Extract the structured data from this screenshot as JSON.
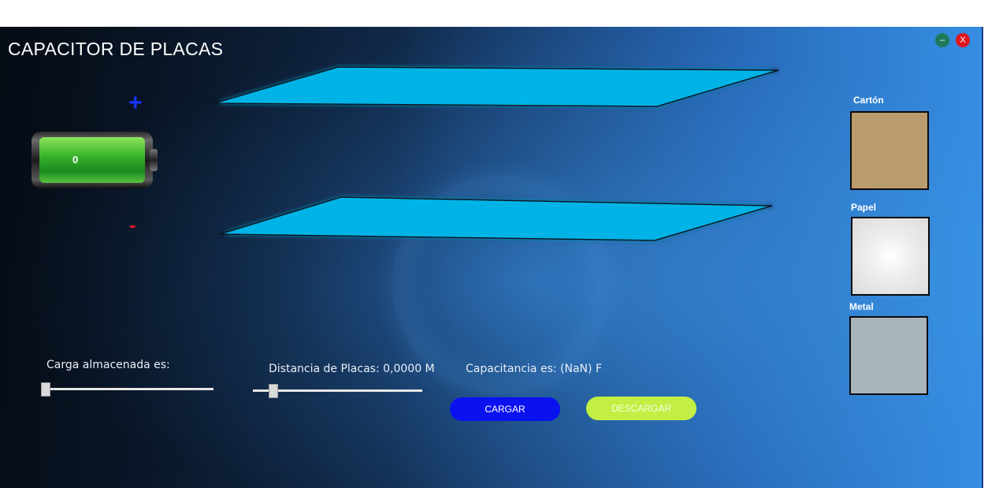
{
  "window": {
    "title": "CAPACITOR DE PLACAS",
    "minimize_label": "–",
    "close_label": "X"
  },
  "battery": {
    "value": "0",
    "positive_symbol": "+",
    "negative_symbol": "-"
  },
  "materials": [
    {
      "label": "Cartón",
      "color": "#b99b6c"
    },
    {
      "label": "Papel",
      "color": "#e9e9e9"
    },
    {
      "label": "Metal",
      "color": "#a9b5bb"
    }
  ],
  "controls": {
    "charge_label": "Carga almacenada es:",
    "charge_level": 0.0,
    "distance_label": "Distancia de Placas: 0,0000 M",
    "distance_level": 0.1,
    "capacitance_label": "Capacitancia es: (NaN) F"
  },
  "buttons": {
    "cargar": "CARGAR",
    "descargar": "DESCARGAR"
  },
  "colors": {
    "plate": "#00b3e6",
    "cargar": "#0a12f0",
    "descargar": "#c3ef45"
  }
}
